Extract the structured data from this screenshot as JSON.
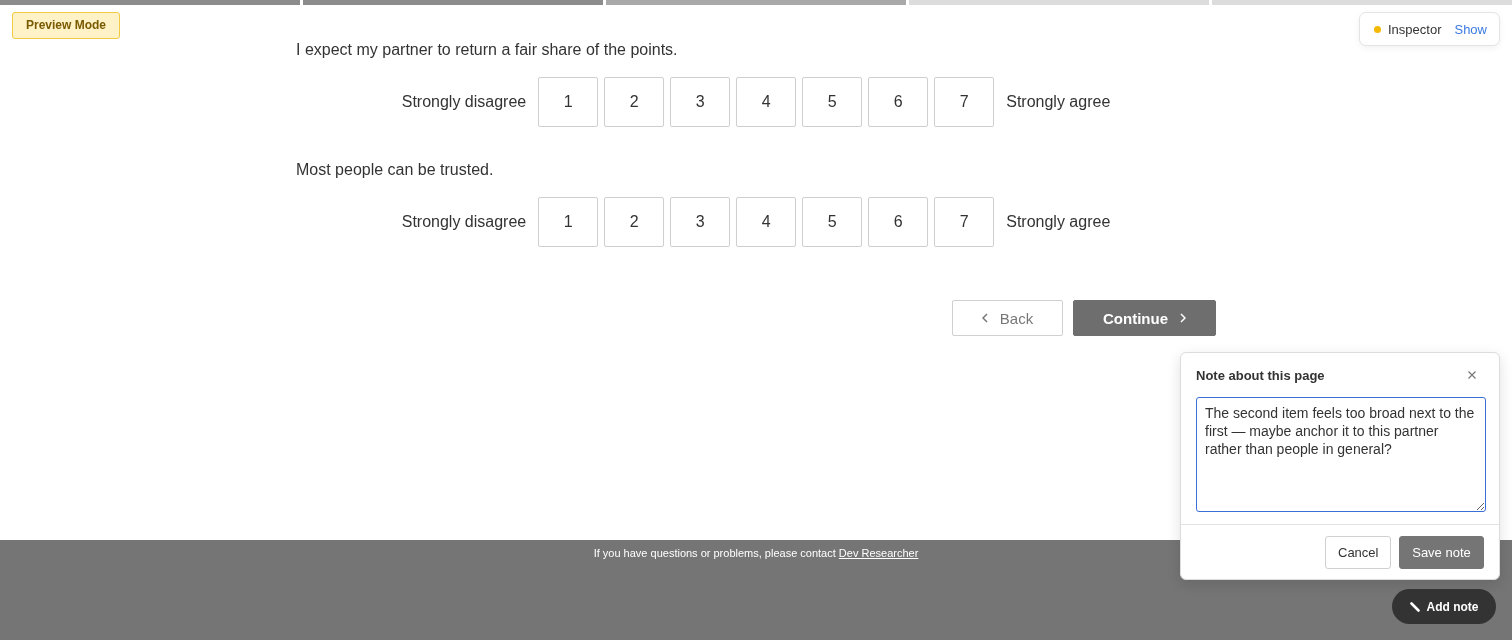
{
  "progress": {
    "segments": [
      {
        "completed": true,
        "current": false
      },
      {
        "completed": true,
        "current": false
      },
      {
        "completed": false,
        "current": true
      },
      {
        "completed": false,
        "current": false
      },
      {
        "completed": false,
        "current": false
      }
    ]
  },
  "preview_badge": {
    "label": "Preview Mode"
  },
  "inspector": {
    "label": "Inspector",
    "action": "Show"
  },
  "questions": [
    {
      "text": "I expect my partner to return a fair share of the points.",
      "low_label": "Strongly disagree",
      "high_label": "Strongly agree",
      "options": [
        {
          "label": "1",
          "selected": false
        },
        {
          "label": "2",
          "selected": false
        },
        {
          "label": "3",
          "selected": false
        },
        {
          "label": "4",
          "selected": false
        },
        {
          "label": "5",
          "selected": false
        },
        {
          "label": "6",
          "selected": false
        },
        {
          "label": "7",
          "selected": false
        }
      ]
    },
    {
      "text": "Most people can be trusted.",
      "low_label": "Strongly disagree",
      "high_label": "Strongly agree",
      "options": [
        {
          "label": "1",
          "selected": false
        },
        {
          "label": "2",
          "selected": false
        },
        {
          "label": "3",
          "selected": false
        },
        {
          "label": "4",
          "selected": false
        },
        {
          "label": "5",
          "selected": false
        },
        {
          "label": "6",
          "selected": false
        },
        {
          "label": "7",
          "selected": false
        }
      ]
    }
  ],
  "navigation": {
    "back": "Back",
    "continue": "Continue"
  },
  "footer": {
    "text": "If you have questions or problems, please contact",
    "link": "Dev Researcher"
  },
  "note_panel": {
    "title": "Note about this page",
    "text": "The second item feels too broad next to the first — maybe anchor it to this partner rather than people in general?",
    "buttons": [
      "Cancel",
      "Save note"
    ]
  },
  "add_note_button": {
    "label": "Add note"
  }
}
